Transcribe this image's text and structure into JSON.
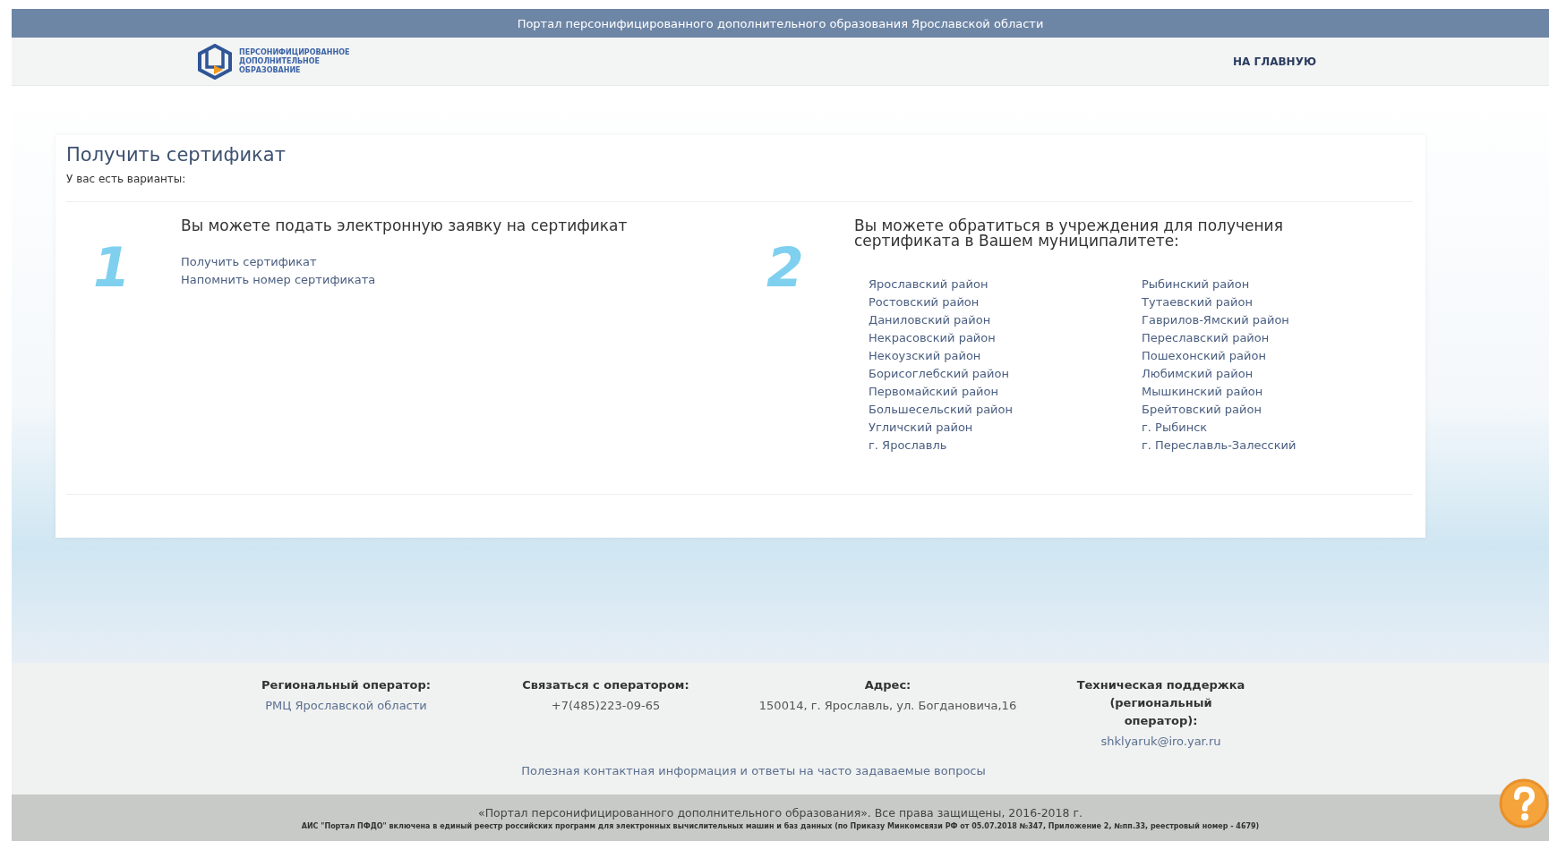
{
  "top_bar": {
    "title": "Портал персонифицированного дополнительного образования Ярославской области"
  },
  "header": {
    "logo_lines": [
      "ПЕРСОНИФИЦИРОВАННОЕ",
      "ДОПОЛНИТЕЛЬНОЕ",
      "ОБРАЗОВАНИЕ"
    ],
    "nav_link": "НА ГЛАВНУЮ"
  },
  "card": {
    "title": "Получить сертификат",
    "subtitle": "У вас есть варианты:",
    "option_1": {
      "number": "1",
      "heading": "Вы можете подать электронную заявку на сертификат",
      "links": [
        "Получить сертификат",
        "Напомнить номер сертификата"
      ]
    },
    "option_2": {
      "number": "2",
      "heading": "Вы можете обратиться в учреждения для получения сертификата в Вашем муниципалитете:",
      "districts_left": [
        "Ярославский район",
        "Ростовский район",
        "Даниловский район",
        "Некрасовский район",
        "Некоузский район",
        "Борисоглебский район",
        "Первомайский район",
        "Большесельский район",
        "Угличский район",
        "г. Ярославль"
      ],
      "districts_right": [
        "Рыбинский район",
        "Тутаевский район",
        "Гаврилов-Ямский район",
        "Переславский район",
        "Пошехонский район",
        "Любимский район",
        "Мышкинский район",
        "Брейтовский район",
        "г. Рыбинск",
        "г. Переславль-Залесский"
      ]
    }
  },
  "footer": {
    "columns": [
      {
        "heading": "Региональный оператор:",
        "value": "РМЦ Ярославской области",
        "kind": "link"
      },
      {
        "heading": "Связаться с оператором:",
        "value": "+7(485)223-09-65",
        "kind": "text"
      },
      {
        "heading": "Адрес:",
        "value": "150014, г. Ярославль, ул. Богдановича,16",
        "kind": "text"
      },
      {
        "heading": "Техническая поддержка (региональный оператор):",
        "value": "shklyaruk@iro.yar.ru",
        "kind": "link"
      }
    ],
    "faq_link": "Полезная контактная информация и ответы на часто задаваемые вопросы",
    "copyright": "«Портал персонифицированного дополнительного образования». Все права защищены, 2016-2018 г.",
    "registry_note": "АИС \"Портал ПФДО\" включена в единый реестр российских программ для электронных вычислительных машин и баз данных (по Приказу Минкомсвязи РФ от 05.07.2018 №347, Приложение 2, №пп.33, реестровый номер - 4679)"
  }
}
